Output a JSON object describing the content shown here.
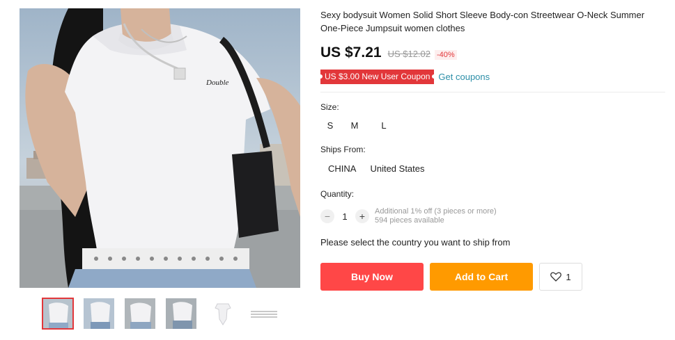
{
  "product": {
    "title": "Sexy bodysuit Women Solid Short Sleeve Body-con Streetwear O-Neck Summer One-Piece Jumpsuit women clothes",
    "price": "US $7.21",
    "original_price": "US $12.02",
    "discount": "-40%",
    "coupon": "US $3.00 New User Coupon",
    "get_coupons": "Get coupons",
    "shirt_print": "Double"
  },
  "size": {
    "label": "Size:",
    "options": [
      "S",
      "M",
      "L"
    ]
  },
  "ships": {
    "label": "Ships From:",
    "options": [
      "CHINA",
      "United States"
    ]
  },
  "quantity": {
    "label": "Quantity:",
    "minus": "−",
    "plus": "+",
    "value": "1",
    "additional": "Additional 1% off (3 pieces or more)",
    "available": "594 pieces available"
  },
  "ship_prompt": "Please select the country you want to ship from",
  "actions": {
    "buy_now": "Buy Now",
    "add_to_cart": "Add to Cart",
    "wishlist_count": "1"
  },
  "colors": {
    "accent_red": "#ff4747",
    "accent_orange": "#ff9a00",
    "coupon_red": "#e2373a",
    "link_teal": "#2d8fa8"
  },
  "gallery": {
    "thumbnail_count": 6,
    "selected_index": 0
  }
}
